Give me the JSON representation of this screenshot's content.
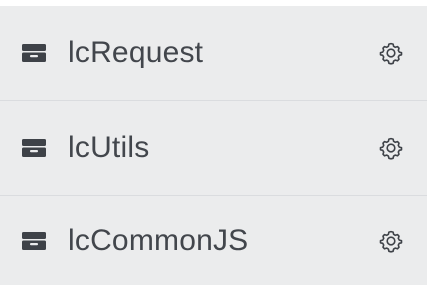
{
  "modules": {
    "items": [
      {
        "label": "lcRequest",
        "icon": "archive-box-icon",
        "action_icon": "gear-icon"
      },
      {
        "label": "lcUtils",
        "icon": "archive-box-icon",
        "action_icon": "gear-icon"
      },
      {
        "label": "lcCommonJS",
        "icon": "archive-box-icon",
        "action_icon": "gear-icon"
      }
    ]
  },
  "colors": {
    "row_background": "#ebeced",
    "divider": "#dadcdf",
    "text": "#42464c",
    "icon": "#3e4248"
  }
}
